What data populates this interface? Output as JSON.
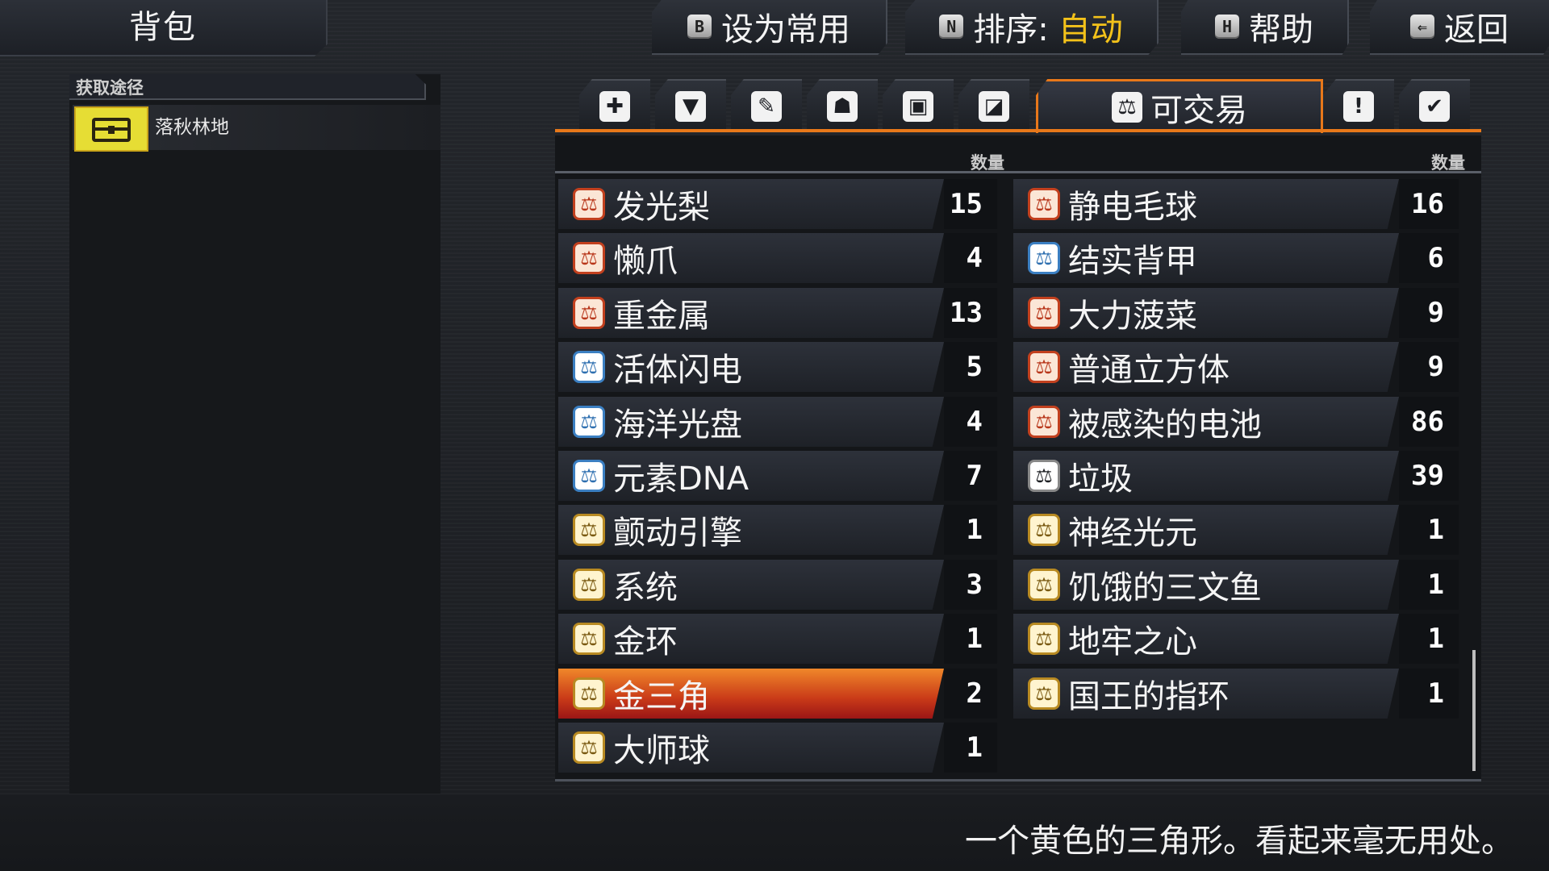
{
  "screen": {
    "title": "背包"
  },
  "top_buttons": [
    {
      "key": "B",
      "label": "设为常用",
      "icon": "b-key-icon"
    },
    {
      "key": "N",
      "label": "排序:",
      "value": "自动",
      "icon": "n-key-icon"
    },
    {
      "key": "H",
      "label": "帮助",
      "icon": "h-key-icon"
    },
    {
      "key": "⇐",
      "label": "返回",
      "icon": "back-key-icon"
    }
  ],
  "source_panel": {
    "header": "获取途径",
    "location": "落秋林地",
    "location_icon": "chest-icon",
    "location_icon_color": "#e6dd34"
  },
  "category_tabs": [
    {
      "icon": "plus-icon",
      "glyph": "✚"
    },
    {
      "icon": "potion-icon",
      "glyph": "▼"
    },
    {
      "icon": "feather-icon",
      "glyph": "✎"
    },
    {
      "icon": "helmet-icon",
      "glyph": "☗"
    },
    {
      "icon": "armor-icon",
      "glyph": "▣"
    },
    {
      "icon": "card-icon",
      "glyph": "◪"
    },
    {
      "icon": "trade-icon",
      "glyph": "⚖",
      "label": "可交易",
      "active": true
    },
    {
      "icon": "key-item-icon",
      "glyph": "ǃ"
    },
    {
      "icon": "check-icon",
      "glyph": "✔"
    }
  ],
  "list": {
    "count_header": "数量",
    "left_column": [
      {
        "name": "发光梨",
        "count": "15",
        "icon_color": "orange"
      },
      {
        "name": "懒爪",
        "count": "4",
        "icon_color": "orange"
      },
      {
        "name": "重金属",
        "count": "13",
        "icon_color": "orange"
      },
      {
        "name": "活体闪电",
        "count": "5",
        "icon_color": "blue"
      },
      {
        "name": "海洋光盘",
        "count": "4",
        "icon_color": "blue"
      },
      {
        "name": "元素DNA",
        "count": "7",
        "icon_color": "blue"
      },
      {
        "name": "颤动引擎",
        "count": "1",
        "icon_color": "gold"
      },
      {
        "name": "系统",
        "count": "3",
        "icon_color": "gold"
      },
      {
        "name": "金环",
        "count": "1",
        "icon_color": "gold"
      },
      {
        "name": "金三角",
        "count": "2",
        "icon_color": "gold",
        "selected": true
      },
      {
        "name": "大师球",
        "count": "1",
        "icon_color": "gold"
      }
    ],
    "right_column": [
      {
        "name": "静电毛球",
        "count": "16",
        "icon_color": "orange"
      },
      {
        "name": "结实背甲",
        "count": "6",
        "icon_color": "blue"
      },
      {
        "name": "大力菠菜",
        "count": "9",
        "icon_color": "orange"
      },
      {
        "name": "普通立方体",
        "count": "9",
        "icon_color": "orange"
      },
      {
        "name": "被感染的电池",
        "count": "86",
        "icon_color": "orange"
      },
      {
        "name": "垃圾",
        "count": "39",
        "icon_color": "white"
      },
      {
        "name": "神经光元",
        "count": "1",
        "icon_color": "gold"
      },
      {
        "name": "饥饿的三文鱼",
        "count": "1",
        "icon_color": "gold"
      },
      {
        "name": "地牢之心",
        "count": "1",
        "icon_color": "gold"
      },
      {
        "name": "国王的指环",
        "count": "1",
        "icon_color": "gold"
      }
    ]
  },
  "description": "一个黄色的三角形。看起来毫无用处。",
  "colors": {
    "accent": "#e8781a",
    "sort_value": "#f3c21a",
    "selected_row": "#c93a18"
  }
}
